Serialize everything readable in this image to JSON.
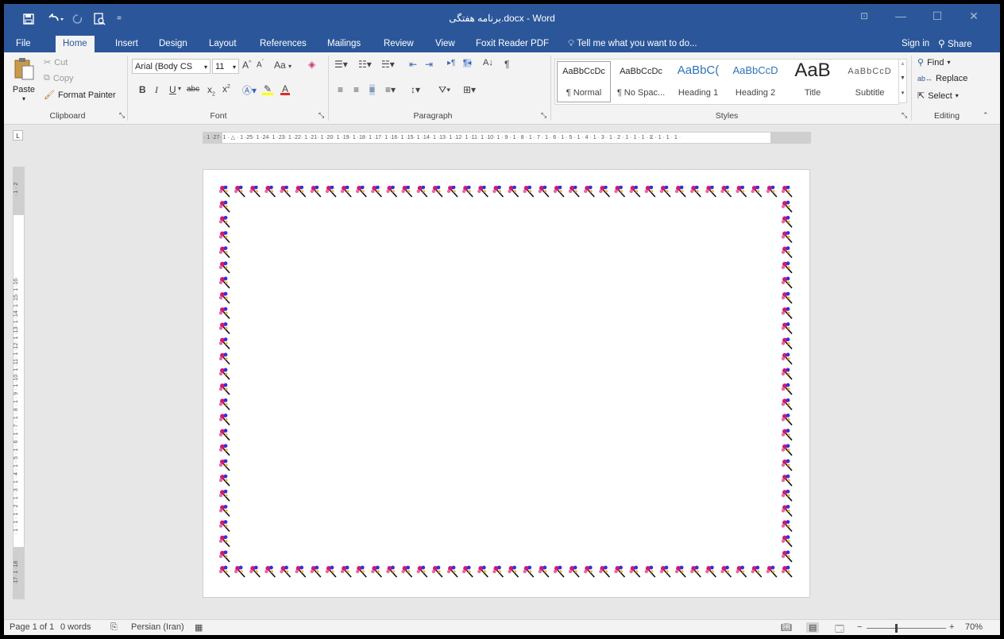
{
  "window": {
    "title": "برنامه هفتگی.docx - Word"
  },
  "quick_access": {
    "save_icon": "save-icon",
    "undo_icon": "undo-icon",
    "redo_icon": "redo-icon",
    "print_preview_icon": "print-preview-icon",
    "customize_icon": "customize-qat-icon"
  },
  "tabs": [
    "File",
    "Home",
    "Insert",
    "Design",
    "Layout",
    "References",
    "Mailings",
    "Review",
    "View",
    "Foxit Reader PDF"
  ],
  "tell_me": "Tell me what you want to do...",
  "sign_in": "Sign in",
  "share": "Share",
  "clipboard": {
    "paste": "Paste",
    "cut": "Cut",
    "copy": "Copy",
    "format_painter": "Format Painter",
    "label": "Clipboard"
  },
  "font": {
    "name": "Arial (Body CS",
    "size": "11",
    "label": "Font",
    "case": "Aa"
  },
  "paragraph": {
    "label": "Paragraph"
  },
  "styles": {
    "label": "Styles",
    "items": [
      {
        "preview": "AaBbCcDc",
        "name": "¶ Normal"
      },
      {
        "preview": "AaBbCcDc",
        "name": "¶ No Spac..."
      },
      {
        "preview": "AaBbC(",
        "name": "Heading 1"
      },
      {
        "preview": "AaBbCcD",
        "name": "Heading 2"
      },
      {
        "preview": "AaB",
        "name": "Title"
      },
      {
        "preview": "AaBbCcD",
        "name": "Subtitle"
      }
    ]
  },
  "editing": {
    "find": "Find",
    "replace": "Replace",
    "select": "Select",
    "label": "Editing"
  },
  "ruler": {
    "h_ticks": "· 1 ·27· 1 · △ · 1 ·25· 1 ·24· 1 ·23· 1 ·22· 1 ·21· 1 ·20· 1 ·19· 1 ·18· 1 ·17· 1 ·16· 1 ·15· 1 ·14· 1 ·13· 1 ·12· 1 ·11· 1 ·10· 1 · 9 · 1 · 8 · 1 · 7 · 1 · 6 · 1 · 5 · 1 · 4 · 1 · 3 · 1 · 2 · 1 · 1 · 1 · ⧖ · 1 · 1 · 1 ·"
  },
  "status": {
    "page": "Page 1 of 1",
    "words": "0 words",
    "language": "Persian (Iran)",
    "zoom": "70%"
  },
  "colors": {
    "accent": "#2b579a",
    "ribbon": "#f3f3f3"
  }
}
